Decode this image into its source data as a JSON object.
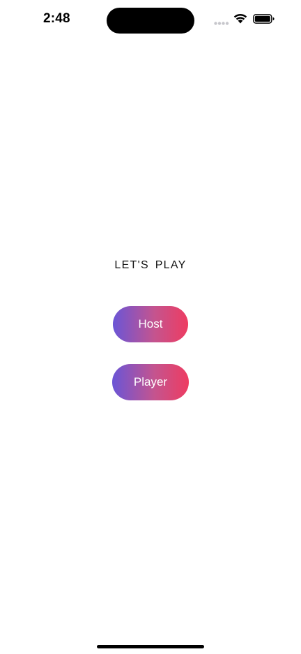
{
  "status_bar": {
    "time": "2:48",
    "icons": [
      "cellular-signal-icon",
      "wifi-icon",
      "battery-icon"
    ]
  },
  "main": {
    "heading": "LET'S  PLAY",
    "buttons": [
      {
        "label": "Host"
      },
      {
        "label": "Player"
      }
    ]
  },
  "colors": {
    "button_gradient_start": "#6a55d6",
    "button_gradient_end": "#ee3c61",
    "background": "#ffffff"
  }
}
